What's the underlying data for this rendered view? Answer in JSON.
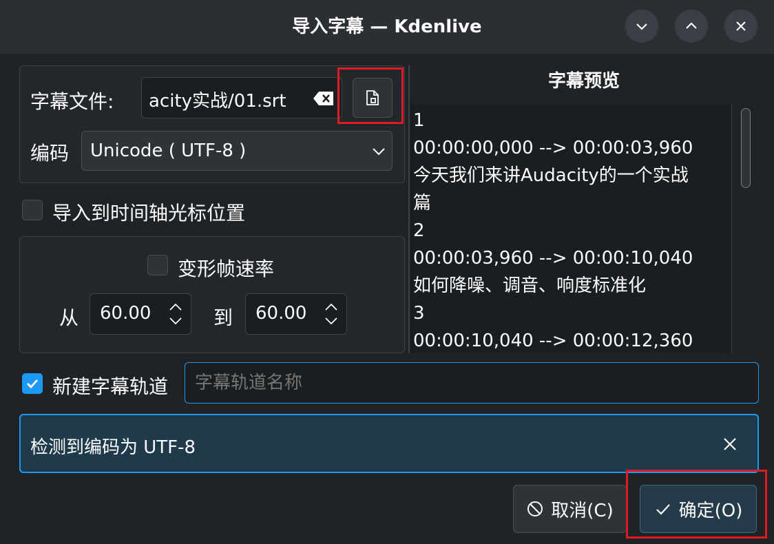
{
  "window": {
    "title": "导入字幕 — Kdenlive"
  },
  "file": {
    "label": "字幕文件:",
    "value": "acity实战/01.srt"
  },
  "encoding": {
    "label": "编码",
    "selected": "Unicode ( UTF-8 )"
  },
  "import_to_cursor": {
    "label": "导入到时间轴光标位置",
    "checked": false
  },
  "framerate": {
    "transform_label": "变形帧速率",
    "transform_checked": false,
    "from_label": "从",
    "from_value": "60.00",
    "to_label": "到",
    "to_value": "60.00"
  },
  "new_track": {
    "label": "新建字幕轨道",
    "checked": true,
    "placeholder": "字幕轨道名称"
  },
  "preview": {
    "title": "字幕预览",
    "lines": [
      "1",
      "00:00:00,000 --> 00:00:03,960",
      "今天我们来讲Audacity的一个实战",
      "篇",
      "2",
      "00:00:03,960 --> 00:00:10,040",
      "如何降噪、调音、响度标准化",
      "3",
      "00:00:10,040 --> 00:00:12,360"
    ]
  },
  "message": {
    "text": "检测到编码为 UTF-8"
  },
  "buttons": {
    "cancel": "取消(C)",
    "ok": "确定(O)"
  },
  "colors": {
    "accent": "#1d99f3",
    "highlight": "#e01b24",
    "message_bg": "#1f3a4a"
  }
}
